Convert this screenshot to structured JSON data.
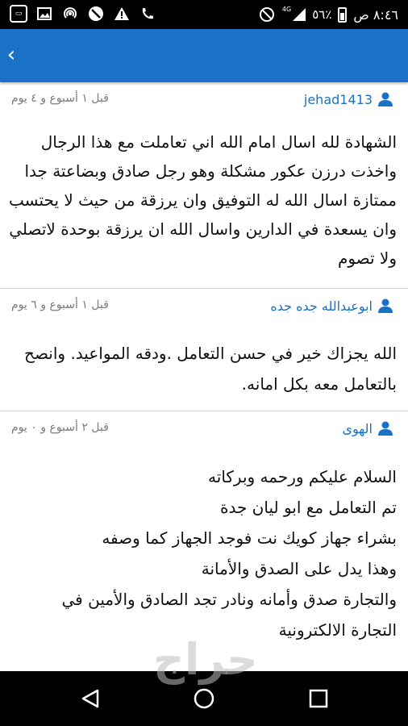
{
  "status_bar": {
    "time": "٨:٤٦ ص",
    "battery": "٥٦٪",
    "network": "4G",
    "icons": [
      "app-icon",
      "image-icon",
      "hotspot-icon",
      "block-icon",
      "warning-icon",
      "phone-icon",
      "no-disturb-icon",
      "signal-icon",
      "battery-icon"
    ]
  },
  "app_bar": {
    "color": "#1a72c6",
    "back_icon": "chevron-left-icon"
  },
  "reviews": [
    {
      "user": "jehad1413",
      "time": "قبل ١ أسبوع و ٤ يوم",
      "lines": [
        "الشهادة لله اسال امام الله اني تعاملت مع هذا الرجال",
        "واخذت درزن عكور مشكلة وهو رجل صادق وبضاعتة جدا",
        "ممتازة اسال الله له التوفيق وان يرزقة من حيث لا يحتسب",
        "وان يسعدة في الدارين واسال الله ان يرزقة بوحدة لاتصلي",
        "ولا تصوم"
      ]
    },
    {
      "user": "ابوعبدالله جده  جده",
      "time": "قبل ١ أسبوع و ٦ يوم",
      "lines": [
        "الله يجزاك خير في حسن التعامل .ودقه  المواعيد. وانصح",
        "بالتعامل معه بكل امانه."
      ]
    },
    {
      "user": "الهوى",
      "time": "قبل ٢ أسبوع و ٠ يوم",
      "lines": [
        "السلام عليكم ورحمه وبركاته",
        "تم التعامل مع ابو ليان جدة",
        "بشراء جهاز كويك نت فوجد الجهاز كما وصفه",
        "وهذا يدل على الصدق والأمانة",
        "والتجارة صدق وأمانه ونادر تجد الصادق والأمين في",
        "التجارة الالكترونية"
      ]
    }
  ],
  "watermark": "حراج",
  "nav_bar": {
    "icons": [
      "nav-back-icon",
      "nav-home-icon",
      "nav-recent-icon"
    ]
  }
}
